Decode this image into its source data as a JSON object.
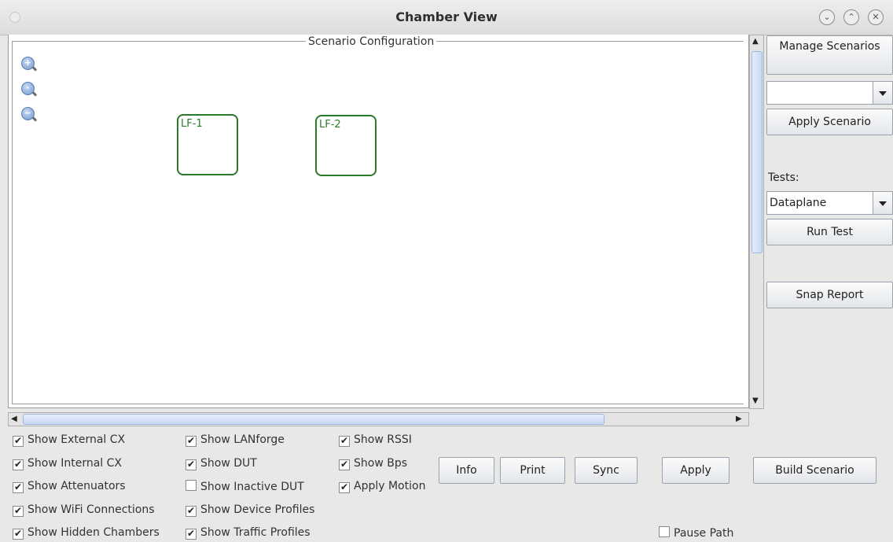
{
  "window": {
    "title": "Chamber View"
  },
  "scenario": {
    "group_title": "Scenario Configuration",
    "nodes": [
      "LF-1",
      "LF-2"
    ]
  },
  "side": {
    "manage_scenarios": "Manage Scenarios",
    "scenario_select": "",
    "apply_scenario": "Apply Scenario",
    "tests_label": "Tests:",
    "tests_select": "Dataplane",
    "run_test": "Run Test",
    "snap_report": "Snap Report"
  },
  "checkboxes": [
    {
      "label": "Show External CX",
      "checked": true
    },
    {
      "label": "Show Internal CX",
      "checked": true
    },
    {
      "label": "Show Attenuators",
      "checked": true
    },
    {
      "label": "Show WiFi Connections",
      "checked": true
    },
    {
      "label": "Show Hidden Chambers",
      "checked": true
    },
    {
      "label": "Show LANforge",
      "checked": true
    },
    {
      "label": "Show DUT",
      "checked": true
    },
    {
      "label": "Show Inactive DUT",
      "checked": false
    },
    {
      "label": "Show Device Profiles",
      "checked": true
    },
    {
      "label": "Show Traffic Profiles",
      "checked": true
    },
    {
      "label": "Show RSSI",
      "checked": true
    },
    {
      "label": "Show Bps",
      "checked": true
    },
    {
      "label": "Apply Motion",
      "checked": true
    },
    {
      "label": "Pause Path",
      "checked": false
    }
  ],
  "actions": {
    "info": "Info",
    "print": "Print",
    "sync": "Sync",
    "apply": "Apply",
    "build_scenario": "Build Scenario"
  },
  "icons": {
    "zoom_in": "zoom-in-icon",
    "zoom_reset": "zoom-reset-icon",
    "zoom_out": "zoom-out-icon"
  }
}
